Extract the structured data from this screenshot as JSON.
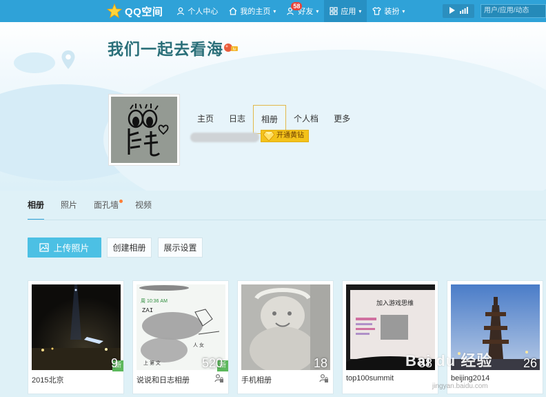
{
  "topbar": {
    "brand": "QQ空间",
    "nav": [
      {
        "label": "个人中心",
        "icon": "person-icon"
      },
      {
        "label": "我的主页",
        "icon": "home-icon"
      },
      {
        "label": "好友",
        "icon": "friends-icon",
        "badge": "58"
      },
      {
        "label": "应用",
        "icon": "apps-grid-icon"
      },
      {
        "label": "装扮",
        "icon": "shirt-icon"
      }
    ],
    "search_placeholder": "用户/应用/动态"
  },
  "profile": {
    "title": "我们一起去看海",
    "tabs": [
      "主页",
      "日志",
      "相册",
      "个人档",
      "更多"
    ],
    "active_tab": "相册",
    "vip_button": "开通黄钻"
  },
  "album_page": {
    "tabs": [
      "相册",
      "照片",
      "面孔墙",
      "视频"
    ],
    "active_tab": "相册",
    "upload_button": "上传照片",
    "create_button": "创建相册",
    "display_button": "展示设置"
  },
  "albums": [
    {
      "name": "2015北京",
      "count": "9",
      "new": "新",
      "locked": false
    },
    {
      "name": "说说和日志相册",
      "count": "520",
      "new": "新",
      "locked": true
    },
    {
      "name": "手机相册",
      "count": "18",
      "locked": true
    },
    {
      "name": "top100summit",
      "count": "88"
    },
    {
      "name": "beijing2014",
      "count": "26"
    }
  ],
  "watermark": "Bai du 经验",
  "watermark_sub": "jingyan.baidu.com",
  "colors": {
    "topbar": "#2fa2d8",
    "accent": "#4cc0e4",
    "title": "#2a6f79",
    "vip": "#f3c21a"
  }
}
